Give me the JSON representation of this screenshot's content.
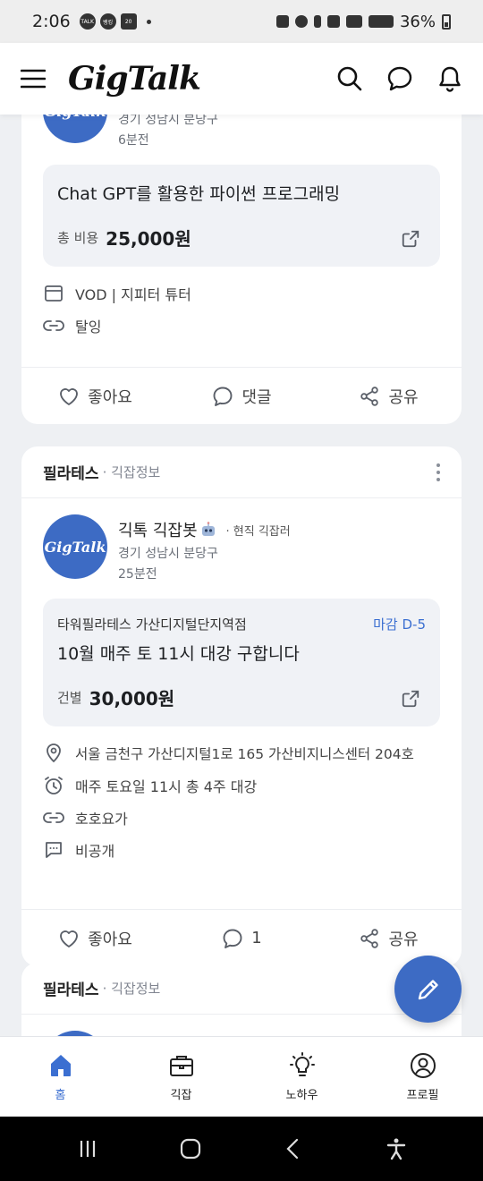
{
  "status_bar": {
    "time": "2:06",
    "chips": [
      "TALK",
      "뱅킹",
      "20"
    ],
    "battery": "36%"
  },
  "app_bar": {
    "logo": "GigTalk",
    "icons": [
      "menu-icon",
      "search-icon",
      "chat-icon",
      "bell-icon"
    ]
  },
  "posts": [
    {
      "author": {
        "avatar_text": "GigTalk",
        "location": "경기 성남시 분당구",
        "time": "6분전"
      },
      "product": {
        "title": "Chat GPT를 활용한 파이썬 프로그래밍",
        "price_label": "총 비용",
        "price": "25,000원"
      },
      "meta": {
        "type": "VOD | 지피터 튜터",
        "link": "탈잉"
      },
      "actions": {
        "like": "좋아요",
        "comment": "댓글",
        "share": "공유"
      }
    },
    {
      "category": "필라테스",
      "subcategory": "· 긱잡정보",
      "author": {
        "avatar_text": "GigTalk",
        "name": "긱톡 긱잡봇",
        "badge": "· 현직 긱잡러",
        "location": "경기 성남시 분당구",
        "time": "25분전"
      },
      "product": {
        "org": "타워필라테스 가산디지털단지역점",
        "deadline": "마감 D-5",
        "title": "10월 매주 토 11시 대강 구합니다",
        "price_label": "건별",
        "price": "30,000원"
      },
      "meta": {
        "address": "서울 금천구 가산디지털1로 165 가산비지니스센터 204호",
        "schedule": "매주 토요일 11시 총 4주 대강",
        "link": "호호요가",
        "chat": "비공개"
      },
      "actions": {
        "like": "좋아요",
        "comment": "1",
        "share": "공유"
      }
    },
    {
      "category": "필라테스",
      "subcategory": "· 긱잡정보"
    }
  ],
  "bottom_nav": [
    {
      "label": "홈",
      "icon": "home-icon",
      "active": true
    },
    {
      "label": "긱잡",
      "icon": "briefcase-icon",
      "active": false
    },
    {
      "label": "노하우",
      "icon": "lightbulb-icon",
      "active": false
    },
    {
      "label": "프로필",
      "icon": "profile-icon",
      "active": false
    }
  ],
  "colors": {
    "accent": "#3b6fd1",
    "fab": "#3d6bc4",
    "background": "#eef0f3"
  }
}
